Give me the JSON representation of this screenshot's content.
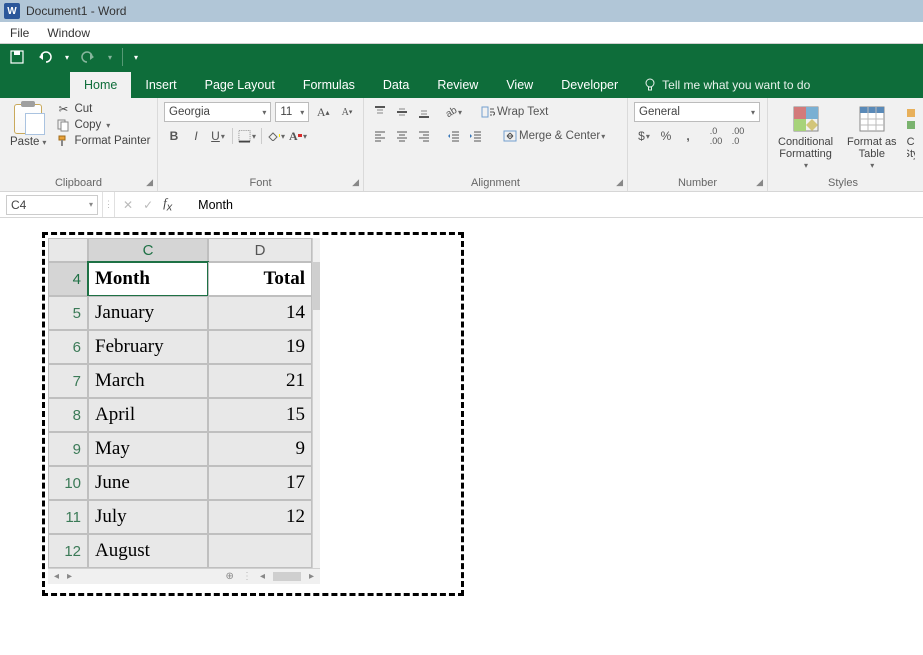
{
  "window": {
    "title": "Document1 - Word"
  },
  "menubar": {
    "items": [
      "File",
      "Window"
    ]
  },
  "tabs": {
    "items": [
      "Home",
      "Insert",
      "Page Layout",
      "Formulas",
      "Data",
      "Review",
      "View",
      "Developer"
    ],
    "active": "Home",
    "tell_me": "Tell me what you want to do"
  },
  "ribbon": {
    "clipboard": {
      "title": "Clipboard",
      "paste": "Paste",
      "cut": "Cut",
      "copy": "Copy",
      "format_painter": "Format Painter"
    },
    "font": {
      "title": "Font",
      "name": "Georgia",
      "size": "11"
    },
    "alignment": {
      "title": "Alignment",
      "wrap": "Wrap Text",
      "merge": "Merge & Center"
    },
    "number": {
      "title": "Number",
      "format": "General"
    },
    "styles": {
      "title": "Styles",
      "cond": "Conditional\nFormatting",
      "table": "Format as\nTable",
      "cell": "C\nSty"
    }
  },
  "formula_bar": {
    "name_box": "C4",
    "formula": "Month"
  },
  "sheet": {
    "visible_columns": [
      "C",
      "D"
    ],
    "visible_row_start": 4,
    "headers": {
      "c": "Month",
      "d": "Total"
    },
    "rows": [
      {
        "n": 5,
        "month": "January",
        "total": "14"
      },
      {
        "n": 6,
        "month": "February",
        "total": "19"
      },
      {
        "n": 7,
        "month": "March",
        "total": "21"
      },
      {
        "n": 8,
        "month": "April",
        "total": "15"
      },
      {
        "n": 9,
        "month": "May",
        "total": "9"
      },
      {
        "n": 10,
        "month": "June",
        "total": "17"
      },
      {
        "n": 11,
        "month": "July",
        "total": "12"
      },
      {
        "n": 12,
        "month": "August",
        "total": ""
      }
    ],
    "active_cell": "C4"
  }
}
